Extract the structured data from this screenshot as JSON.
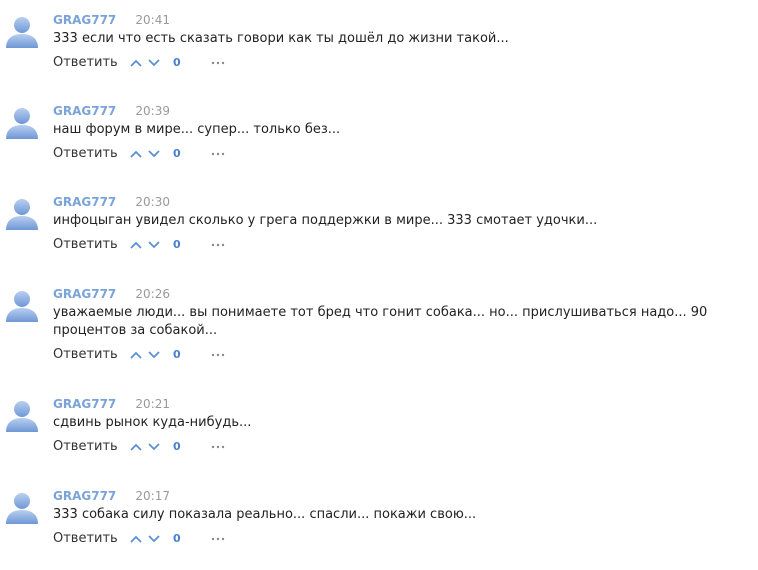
{
  "comments": [
    {
      "author": "GRAG777",
      "time": "20:41",
      "text": "333 если что есть сказать говори как ты дошёл до жизни такой...",
      "reply_label": "Ответить",
      "votes": "0"
    },
    {
      "author": "GRAG777",
      "time": "20:39",
      "text": "наш форум в мире... супер... только без...",
      "reply_label": "Ответить",
      "votes": "0"
    },
    {
      "author": "GRAG777",
      "time": "20:30",
      "text": "инфоцыган увидел сколько у грега поддержки в мире... 333 смотает удочки...",
      "reply_label": "Ответить",
      "votes": "0"
    },
    {
      "author": "GRAG777",
      "time": "20:26",
      "text": "уважаемые люди... вы понимаете тот бред что гонит собака... но... прислушиваться надо... 90 процентов за собакой...",
      "reply_label": "Ответить",
      "votes": "0"
    },
    {
      "author": "GRAG777",
      "time": "20:21",
      "text": "сдвинь рынок куда-нибудь...",
      "reply_label": "Ответить",
      "votes": "0"
    },
    {
      "author": "GRAG777",
      "time": "20:17",
      "text": "333 собака силу показала реально... спасли... покажи свою...",
      "reply_label": "Ответить",
      "votes": "0"
    }
  ],
  "icons": {
    "avatar": "user-silhouette-icon",
    "upvote": "chevron-up-icon",
    "downvote": "chevron-down-icon",
    "more": "more-dots-icon"
  },
  "colors": {
    "author": "#7aa3d8",
    "vote_count": "#4a7fd0",
    "arrow": "#5b8fd6",
    "avatar": "#8aaee0"
  }
}
